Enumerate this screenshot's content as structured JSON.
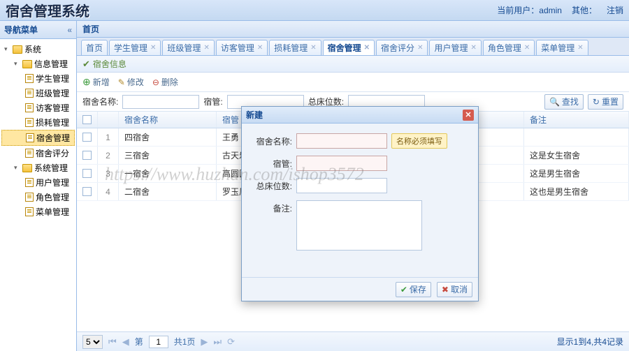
{
  "header": {
    "title": "宿舍管理系统",
    "current_user_label": "当前用户：",
    "current_user": "admin",
    "other_label": "其他：",
    "logout": "注销"
  },
  "sidebar": {
    "title": "导航菜单",
    "nodes": {
      "system": "系统",
      "info_mgmt": "信息管理",
      "student": "学生管理",
      "class": "班级管理",
      "visitor": "访客管理",
      "consume": "损耗管理",
      "dorm": "宿舍管理",
      "rating": "宿舍评分",
      "sys_mgmt": "系统管理",
      "user": "用户管理",
      "role": "角色管理",
      "menu": "菜单管理"
    }
  },
  "crumb": "首页",
  "tabs": [
    {
      "label": "首页"
    },
    {
      "label": "学生管理"
    },
    {
      "label": "班级管理"
    },
    {
      "label": "访客管理"
    },
    {
      "label": "损耗管理"
    },
    {
      "label": "宿舍管理",
      "active": true
    },
    {
      "label": "宿舍评分"
    },
    {
      "label": "用户管理"
    },
    {
      "label": "角色管理"
    },
    {
      "label": "菜单管理"
    }
  ],
  "subhead": "宿舍信息",
  "toolbar": {
    "add": "新增",
    "edit": "修改",
    "del": "删除"
  },
  "search": {
    "name_label": "宿舍名称:",
    "keeper_label": "宿管:",
    "beds_label": "总床位数:",
    "find": "查找",
    "reset": "重置"
  },
  "grid": {
    "cols": {
      "name": "宿舍名称",
      "keeper": "宿管",
      "remark": "备注"
    },
    "rows": [
      {
        "idx": "1",
        "name": "四宿舍",
        "keeper": "王勇",
        "remark": ""
      },
      {
        "idx": "2",
        "name": "三宿舍",
        "keeper": "古天乐",
        "remark": "这是女生宿舍"
      },
      {
        "idx": "3",
        "name": "一宿舍",
        "keeper": "高圆圆",
        "remark": "这是男生宿舍"
      },
      {
        "idx": "4",
        "name": "二宿舍",
        "keeper": "罗玉凤",
        "remark": "这也是男生宿舍"
      }
    ]
  },
  "pager": {
    "page_size": "5",
    "page_label_pre": "第",
    "page": "1",
    "page_label_post": "共1页",
    "status": "显示1到4,共4记录"
  },
  "dialog": {
    "title": "新建",
    "fields": {
      "name": "宿舍名称:",
      "keeper": "宿管:",
      "beds": "总床位数:",
      "remark": "备注:"
    },
    "warn": "名称必须填写",
    "save": "保存",
    "cancel": "取消"
  },
  "watermark": "https://www.huzhan.com/ishop3572"
}
